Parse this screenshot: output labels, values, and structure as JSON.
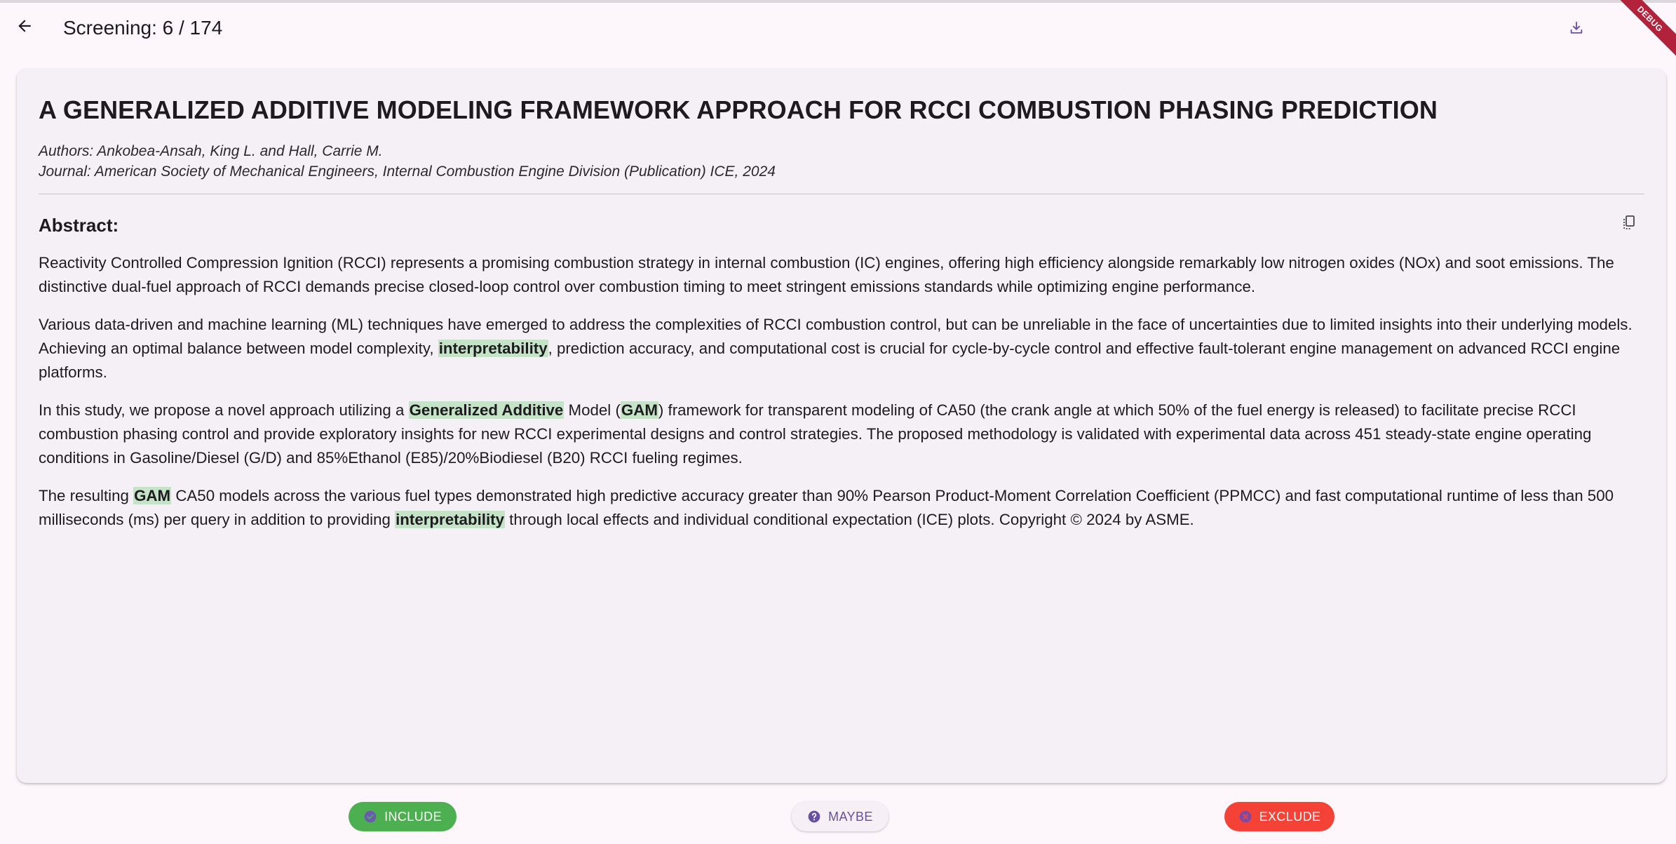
{
  "appbar": {
    "title": "Screening: 6 / 174",
    "debug_label": "DEBUG"
  },
  "paper": {
    "title": "A GENERALIZED ADDITIVE MODELING FRAMEWORK APPROACH FOR RCCI COMBUSTION PHASING PREDICTION",
    "authors": "Authors: Ankobea-Ansah, King L. and Hall, Carrie M.",
    "journal": "Journal: American Society of Mechanical Engineers, Internal Combustion Engine Division (Publication) ICE, 2024"
  },
  "abstract": {
    "heading": "Abstract:",
    "p1": "Reactivity Controlled Compression Ignition (RCCI) represents a promising combustion strategy in internal combustion (IC) engines, offering high efficiency alongside remarkably low nitrogen oxides (NOx) and soot emissions. The distinctive dual-fuel approach of RCCI demands precise closed-loop control over combustion timing to meet stringent emissions standards while optimizing engine performance.",
    "p2_a": "Various data-driven and machine learning (ML) techniques have emerged to address the complexities of RCCI combustion control, but can be unreliable in the face of uncertainties due to limited insights into their underlying models. Achieving an optimal balance between model complexity, ",
    "p2_hl1": "interpretability",
    "p2_b": ", prediction accuracy, and computational cost is crucial for cycle-by-cycle control and effective fault-tolerant engine management on advanced RCCI engine platforms.",
    "p3_a": "In this study, we propose a novel approach utilizing a ",
    "p3_hl1": "Generalized Additive",
    "p3_b": " Model (",
    "p3_hl2": "GAM",
    "p3_c": ") framework for transparent modeling of CA50 (the crank angle at which 50% of the fuel energy is released) to facilitate precise RCCI combustion phasing control and provide exploratory insights for new RCCI experimental designs and control strategies. The proposed methodology is validated with experimental data across 451 steady-state engine operating conditions in Gasoline/Diesel (G/D) and 85%Ethanol (E85)/20%Biodiesel (B20) RCCI fueling regimes.",
    "p4_a": "The resulting ",
    "p4_hl1": "GAM",
    "p4_b": " CA50 models across the various fuel types demonstrated high predictive accuracy greater than 90% Pearson Product-Moment Correlation Coefficient (PPMCC) and fast computational runtime of less than 500 milliseconds (ms) per query in addition to providing ",
    "p4_hl2": "interpretability",
    "p4_c": " through local effects and individual conditional expectation (ICE) plots. Copyright © 2024 by ASME."
  },
  "actions": {
    "include": "INCLUDE",
    "maybe": "MAYBE",
    "exclude": "EXCLUDE"
  },
  "colors": {
    "background": "#fdf7fc",
    "card": "#f5f0f5",
    "highlight": "#c5e3c7",
    "include": "#4caf50",
    "exclude": "#f44336",
    "maybe_text": "#6750a4",
    "debug": "#b3223b"
  },
  "icons": {
    "back": "arrow-left-icon",
    "download": "download-icon",
    "copy": "copy-icon",
    "include": "check-circle-icon",
    "maybe": "help-circle-icon",
    "exclude": "cancel-circle-icon"
  }
}
